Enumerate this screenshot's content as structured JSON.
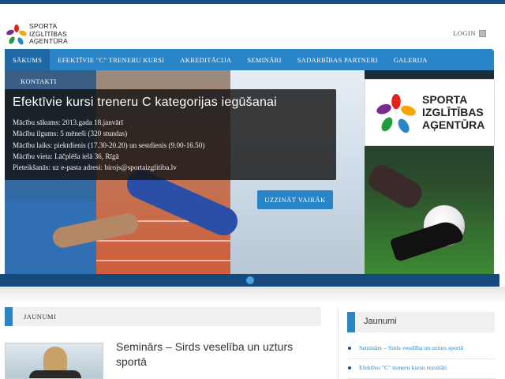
{
  "header": {
    "logo_lines": [
      "SPORTA",
      "IZGLĪTĪBAS",
      "AĢENTŪRA"
    ],
    "login_label": "LOGIN"
  },
  "nav": {
    "items": [
      {
        "label": "SĀKUMS"
      },
      {
        "label": "EFEKTĪVIE \"C\" TRENERU KURSI"
      },
      {
        "label": "AKREDITĀCIJA"
      },
      {
        "label": "SEMINĀRI"
      },
      {
        "label": "SADARBĪBAS PARTNERI"
      },
      {
        "label": "GALERIJA"
      },
      {
        "label": "KONTAKTI"
      }
    ]
  },
  "hero": {
    "title": "Efektīvie kursi treneru C kategorijas iegūšanai",
    "details": [
      "Mācību sākums: 2013.gada 18.janvārī",
      "Mācību ilgums: 5 mēneši (320 stundas)",
      "Mācību laiks: piektdienis (17.30-20.20) un sestdienis (9.00-16.50)",
      "Mācību vieta: Lāčplēša ielā 36, Rīgā",
      "Pieteikšanās: uz e-pasta adresi: birojs@sportaizglitiba.lv"
    ],
    "brand_lines": [
      "SPORTA",
      "IZGLĪTĪBAS",
      "AĢENTŪRA"
    ],
    "more_button": "UZZINĀT VAIRĀK"
  },
  "news": {
    "section_label": "JAUNUMI",
    "article_title": "Seminārs – Sirds veselība un uzturs sportā"
  },
  "sidebar": {
    "title": "Jaunumi",
    "items": [
      "Seminārs – Sirds veselība un uzturs sportā",
      "Efektīvo \"C\" treneru kursu rezultāti"
    ]
  },
  "colors": {
    "brand_blue": "#2a85c8",
    "dark_blue": "#174a7c",
    "accent_dot": "#4aa3e0"
  }
}
